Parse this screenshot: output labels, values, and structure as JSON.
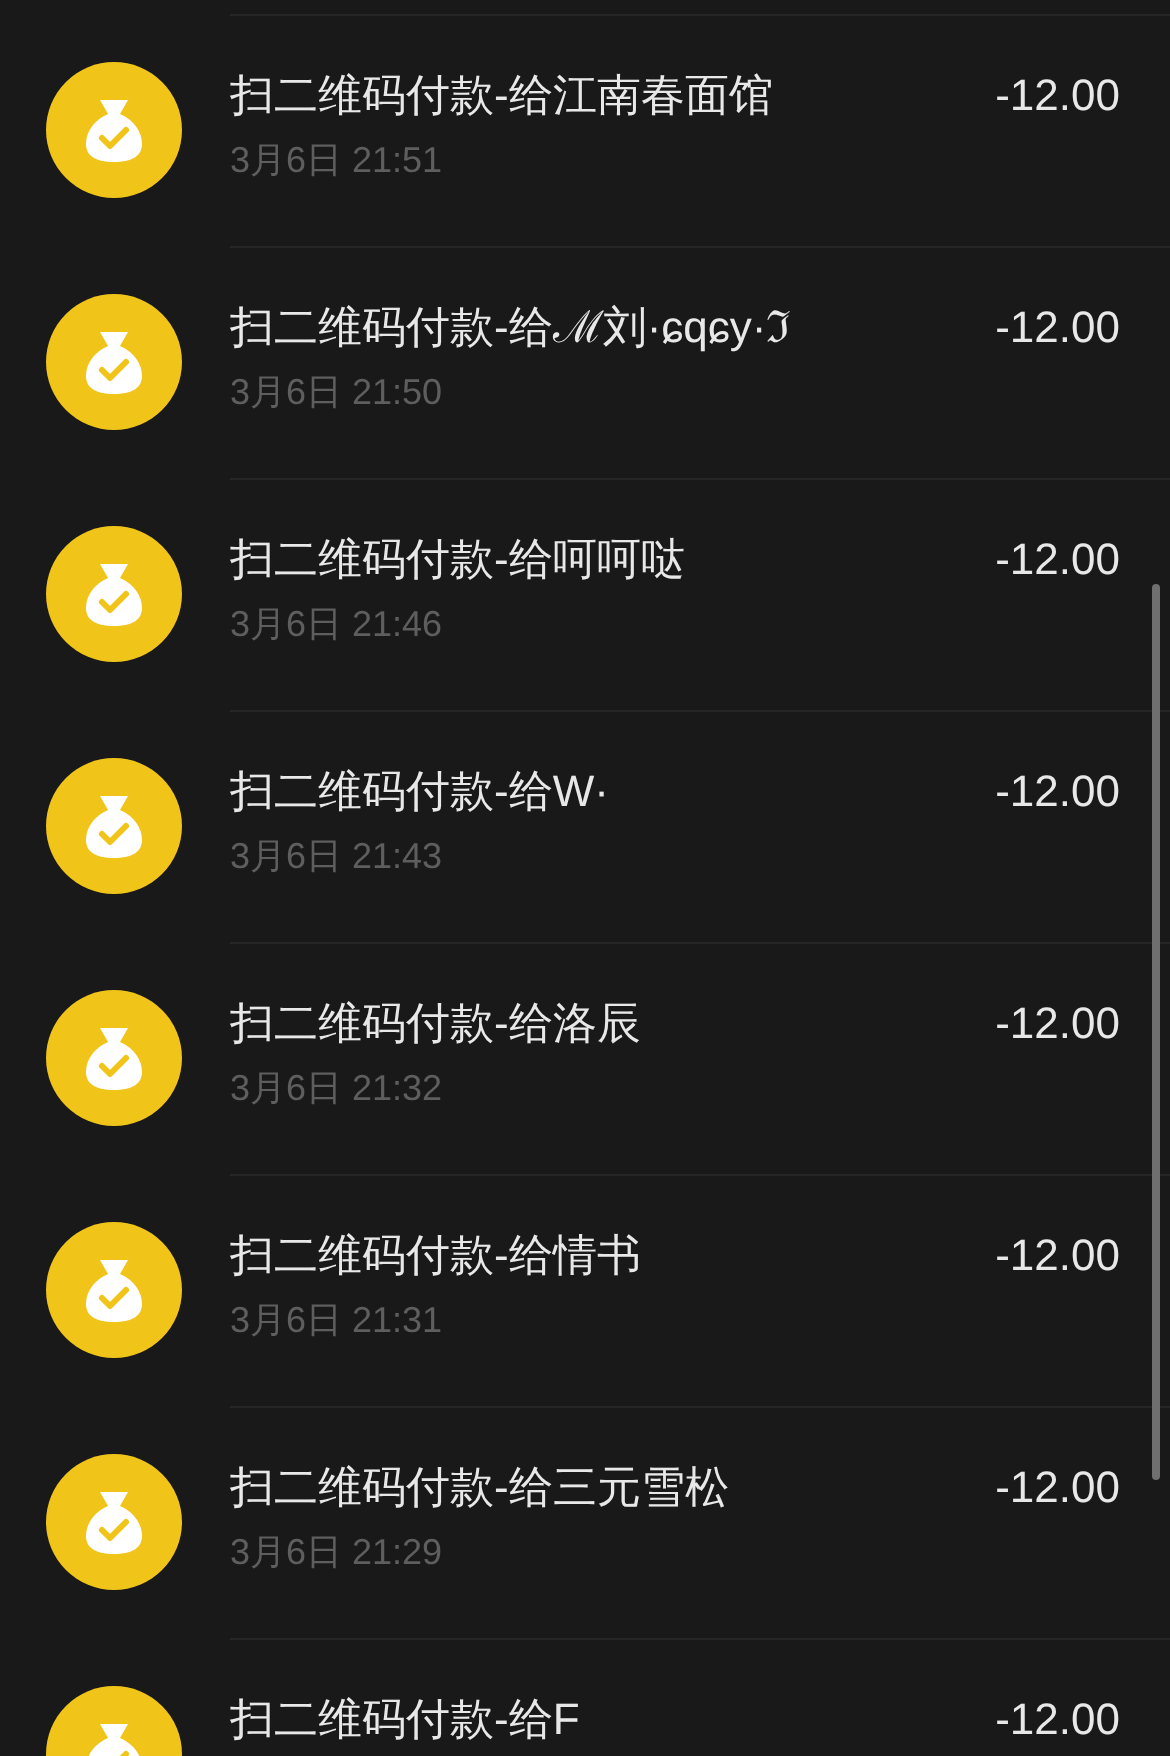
{
  "transactions": [
    {
      "title": "扫二维码付款-给江南春面馆",
      "time": "3月6日 21:51",
      "amount": "-12.00"
    },
    {
      "title": "扫二维码付款-给ℳ刘·ɕqɕy·ℑ",
      "time": "3月6日 21:50",
      "amount": "-12.00"
    },
    {
      "title": "扫二维码付款-给呵呵哒",
      "time": "3月6日 21:46",
      "amount": "-12.00"
    },
    {
      "title": "扫二维码付款-给W·",
      "time": "3月6日 21:43",
      "amount": "-12.00"
    },
    {
      "title": "扫二维码付款-给洛辰",
      "time": "3月6日 21:32",
      "amount": "-12.00"
    },
    {
      "title": "扫二维码付款-给情书",
      "time": "3月6日 21:31",
      "amount": "-12.00"
    },
    {
      "title": "扫二维码付款-给三元雪松",
      "time": "3月6日 21:29",
      "amount": "-12.00"
    },
    {
      "title": "扫二维码付款-给F",
      "amount": "-12.00"
    }
  ]
}
